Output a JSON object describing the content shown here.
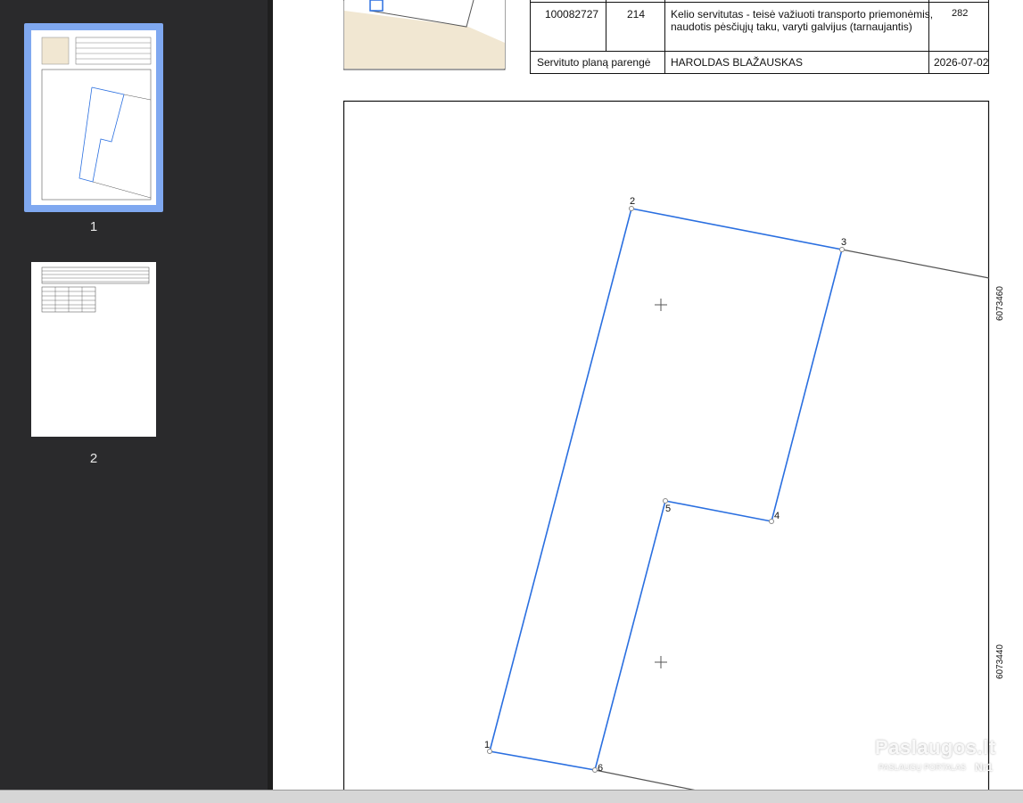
{
  "sidebar": {
    "pages": [
      {
        "label": "1",
        "selected": true
      },
      {
        "label": "2",
        "selected": false
      }
    ]
  },
  "document": {
    "table": {
      "row": {
        "number": "100082727",
        "code": "214",
        "description_line1": "Kelio servitutas - teisė važiuoti transporto priemonėmis,",
        "description_line2": "naudotis pėsčiųjų taku, varyti galvijus (tarnaujantis)",
        "area": "282"
      },
      "footer": {
        "label": "Servituto planą parengė",
        "name": "HAROLDAS BLAŽAUSKAS",
        "date": "2026-07-02"
      }
    },
    "plan": {
      "vertex_labels": [
        "1",
        "2",
        "3",
        "4",
        "5",
        "6"
      ],
      "coordinate_labels": [
        "6073460",
        "6073440"
      ],
      "line_color": "#2a6fe0"
    }
  },
  "watermark": {
    "brand": "Paslaugos.lt",
    "tagline": "PASLAUGŲ PORTALAS",
    "badge": "Nr1"
  }
}
